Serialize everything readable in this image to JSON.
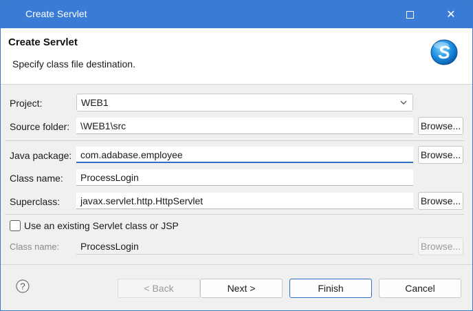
{
  "window": {
    "title": "Create Servlet",
    "controls": {
      "maximize_icon": "maximize-icon",
      "close_label": "✕"
    }
  },
  "header": {
    "title": "Create Servlet",
    "subtitle": "Specify class file destination.",
    "logo_icon": "servlet-wizard-icon",
    "logo_letter": "S"
  },
  "form": {
    "project": {
      "label": "Project:",
      "value": "WEB1"
    },
    "source_folder": {
      "label": "Source folder:",
      "value": "\\WEB1\\src",
      "browse_label": "Browse..."
    },
    "java_package": {
      "label": "Java package:",
      "value": "com.adabase.employee",
      "browse_label": "Browse..."
    },
    "class_name": {
      "label": "Class name:",
      "value": "ProcessLogin"
    },
    "superclass": {
      "label": "Superclass:",
      "value": "javax.servlet.http.HttpServlet",
      "browse_label": "Browse..."
    },
    "use_existing": {
      "label": "Use an existing Servlet class or JSP",
      "checked": false
    },
    "existing_class": {
      "label": "Class name:",
      "value": "ProcessLogin",
      "browse_label": "Browse..."
    }
  },
  "footer": {
    "help_label": "?",
    "back_label": "< Back",
    "next_label": "Next >",
    "finish_label": "Finish",
    "cancel_label": "Cancel"
  },
  "colors": {
    "title_bar": "#3a7bd5",
    "focus_accent": "#2d6fc5"
  }
}
